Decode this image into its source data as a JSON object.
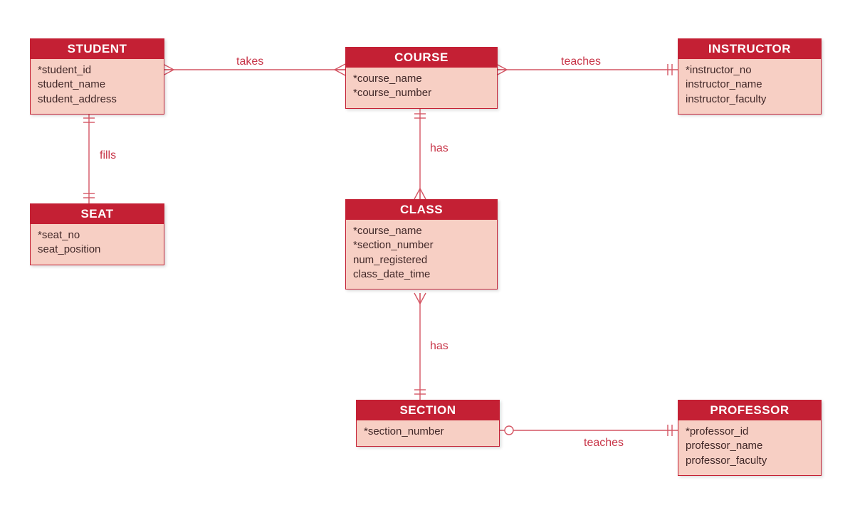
{
  "entities": {
    "student": {
      "title": "STUDENT",
      "attrs": [
        "*student_id",
        "student_name",
        "student_address"
      ]
    },
    "course": {
      "title": "COURSE",
      "attrs": [
        "*course_name",
        "*course_number"
      ]
    },
    "instructor": {
      "title": "INSTRUCTOR",
      "attrs": [
        "*instructor_no",
        "instructor_name",
        "instructor_faculty"
      ]
    },
    "seat": {
      "title": "SEAT",
      "attrs": [
        "*seat_no",
        "seat_position"
      ]
    },
    "class": {
      "title": "CLASS",
      "attrs": [
        "*course_name",
        "*section_number",
        "num_registered",
        "class_date_time"
      ]
    },
    "section": {
      "title": "SECTION",
      "attrs": [
        "*section_number"
      ]
    },
    "professor": {
      "title": "PROFESSOR",
      "attrs": [
        "*professor_id",
        "professor_name",
        "professor_faculty"
      ]
    }
  },
  "relations": {
    "takes": {
      "label": "takes"
    },
    "teaches1": {
      "label": "teaches"
    },
    "fills": {
      "label": "fills"
    },
    "has1": {
      "label": "has"
    },
    "has2": {
      "label": "has"
    },
    "teaches2": {
      "label": "teaches"
    }
  },
  "colors": {
    "header_bg": "#c42034",
    "header_fg": "#ffffff",
    "body_bg": "#f7cfc4",
    "line": "#d45563"
  }
}
